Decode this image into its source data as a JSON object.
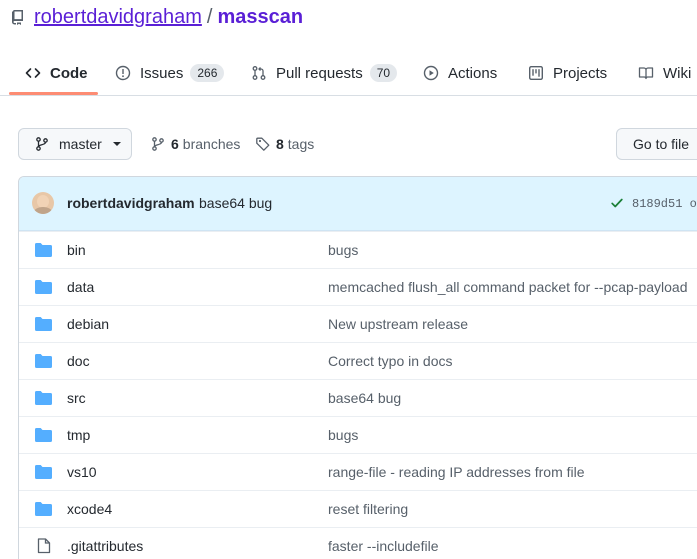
{
  "repo": {
    "owner": "robertdavidgraham",
    "separator": "/",
    "name": "masscan"
  },
  "tabs": [
    {
      "label": "Code",
      "icon": "code-icon",
      "selected": true
    },
    {
      "label": "Issues",
      "icon": "issue-icon",
      "count": "266"
    },
    {
      "label": "Pull requests",
      "icon": "pull-request-icon",
      "count": "70"
    },
    {
      "label": "Actions",
      "icon": "play-icon"
    },
    {
      "label": "Projects",
      "icon": "project-icon"
    },
    {
      "label": "Wiki",
      "icon": "book-icon"
    }
  ],
  "toolbar": {
    "branch": "master",
    "branches_count": "6",
    "branches_label": "branches",
    "tags_count": "8",
    "tags_label": "tags",
    "goto_file": "Go to file"
  },
  "commit": {
    "author": "robertdavidgraham",
    "message": "base64 bug",
    "sha": "8189d51",
    "sha_tail": "o",
    "status": "success"
  },
  "files": [
    {
      "name": "bin",
      "type": "folder",
      "message": "bugs"
    },
    {
      "name": "data",
      "type": "folder",
      "message": "memcached flush_all command packet for --pcap-payload"
    },
    {
      "name": "debian",
      "type": "folder",
      "message": "New upstream release"
    },
    {
      "name": "doc",
      "type": "folder",
      "message": "Correct typo in docs"
    },
    {
      "name": "src",
      "type": "folder",
      "message": "base64 bug"
    },
    {
      "name": "tmp",
      "type": "folder",
      "message": "bugs"
    },
    {
      "name": "vs10",
      "type": "folder",
      "message": "range-file - reading IP addresses from file"
    },
    {
      "name": "xcode4",
      "type": "folder",
      "message": "reset filtering"
    },
    {
      "name": ".gitattributes",
      "type": "file",
      "message": "faster --includefile"
    }
  ],
  "colors": {
    "link": "#5a1fd6",
    "folder": "#54aeff",
    "commit_bar": "#ddf4ff",
    "tab_underline": "#fd8c73",
    "success": "#1a7f37"
  }
}
